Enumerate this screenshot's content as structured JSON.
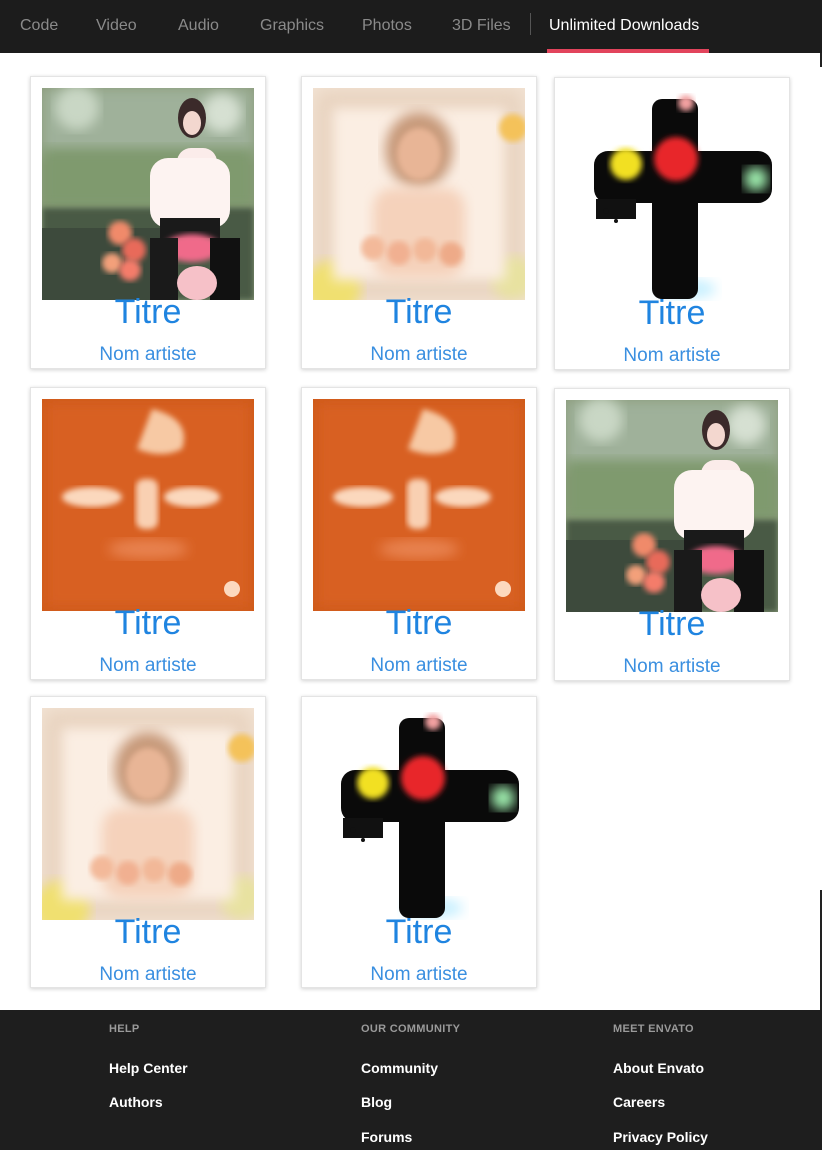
{
  "nav": {
    "tabs": [
      {
        "label": "Code"
      },
      {
        "label": "Video"
      },
      {
        "label": "Audio"
      },
      {
        "label": "Graphics"
      },
      {
        "label": "Photos"
      },
      {
        "label": "3D Files"
      },
      {
        "label": "Unlimited Downloads"
      }
    ],
    "active_tab": "Unlimited Downloads",
    "accent_color": "#e2445c"
  },
  "cards": [
    {
      "title": "Titre",
      "artist": "Nom artiste",
      "artwork": "girl-portrait-painting"
    },
    {
      "title": "Titre",
      "artist": "Nom artiste",
      "artwork": "blurred-portrait-painting"
    },
    {
      "title": "Titre",
      "artist": "Nom artiste",
      "artwork": "black-cross-painting"
    },
    {
      "title": "Titre",
      "artist": "Nom artiste",
      "artwork": "orange-face-painting"
    },
    {
      "title": "Titre",
      "artist": "Nom artiste",
      "artwork": "orange-face-painting"
    },
    {
      "title": "Titre",
      "artist": "Nom artiste",
      "artwork": "girl-portrait-painting"
    },
    {
      "title": "Titre",
      "artist": "Nom artiste",
      "artwork": "blurred-portrait-painting"
    },
    {
      "title": "Titre",
      "artist": "Nom artiste",
      "artwork": "black-cross-painting"
    }
  ],
  "colors": {
    "title": "#1f84e0",
    "artist": "#3a8fe0",
    "footer_bg": "#1e1e1e",
    "nav_bg": "#1c1c1c"
  },
  "footer": {
    "columns": [
      {
        "heading": "HELP",
        "links": [
          "Help Center",
          "Authors"
        ]
      },
      {
        "heading": "OUR COMMUNITY",
        "links": [
          "Community",
          "Blog",
          "Forums"
        ]
      },
      {
        "heading": "MEET ENVATO",
        "links": [
          "About Envato",
          "Careers",
          "Privacy Policy"
        ]
      }
    ]
  }
}
